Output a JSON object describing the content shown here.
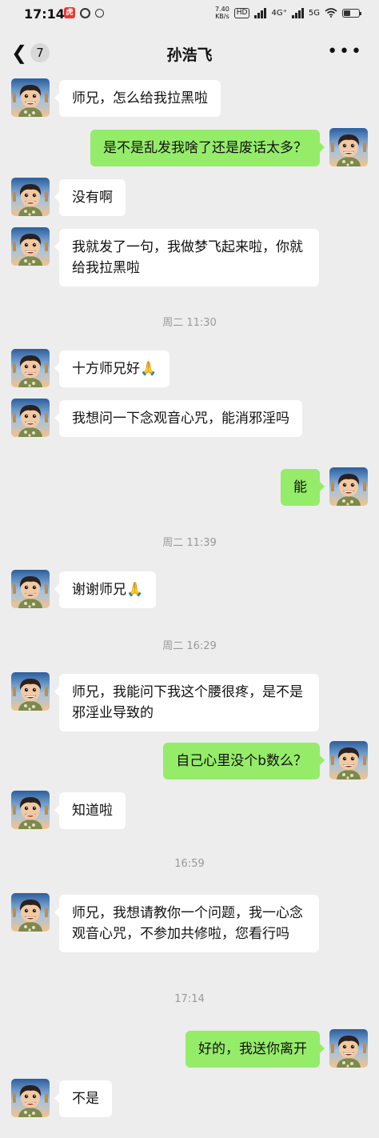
{
  "status_bar": {
    "time": "17:14",
    "net_speed_value": "7.40",
    "net_speed_unit": "KB/s",
    "hd_label": "HD",
    "signal_1": "4G⁺",
    "signal_2": "5G",
    "battery_level": 0.42
  },
  "header": {
    "back_icon": "chevron-left-icon",
    "unread_count": "7",
    "contact_name": "孙浩飞",
    "more_icon": "more-dots-icon"
  },
  "messages": [
    {
      "side": "left",
      "text": "师兄，怎么给我拉黑啦"
    },
    {
      "side": "right",
      "text": "是不是乱发我啥了还是废话太多？"
    },
    {
      "side": "left",
      "text": "没有啊"
    },
    {
      "side": "left",
      "text": "我就发了一句，我做梦飞起来啦，你就给我拉黑啦"
    },
    {
      "side": "time",
      "text": "周二 11:30"
    },
    {
      "side": "left",
      "text": "十方师兄好🙏"
    },
    {
      "side": "left",
      "text": "我想问一下念观音心咒，能消邪淫吗"
    },
    {
      "side": "right",
      "text": "能"
    },
    {
      "side": "time",
      "text": "周二 11:39"
    },
    {
      "side": "left",
      "text": "谢谢师兄🙏"
    },
    {
      "side": "time",
      "text": "周二 16:29"
    },
    {
      "side": "left",
      "text": "师兄，我能问下我这个腰很疼，是不是邪淫业导致的"
    },
    {
      "side": "right",
      "text": "自己心里没个b数么？"
    },
    {
      "side": "left",
      "text": "知道啦"
    },
    {
      "side": "time",
      "text": "16:59"
    },
    {
      "side": "left",
      "text": "师兄，我想请教你一个问题，我一心念观音心咒，不参加共修啦，您看行吗"
    },
    {
      "side": "time",
      "text": "17:14"
    },
    {
      "side": "right",
      "text": "好的，我送你离开"
    },
    {
      "side": "left",
      "text": "不是"
    }
  ],
  "colors": {
    "background": "#ededed",
    "bubble_left": "#ffffff",
    "bubble_right": "#95ec69",
    "timestamp_text": "#999999"
  }
}
